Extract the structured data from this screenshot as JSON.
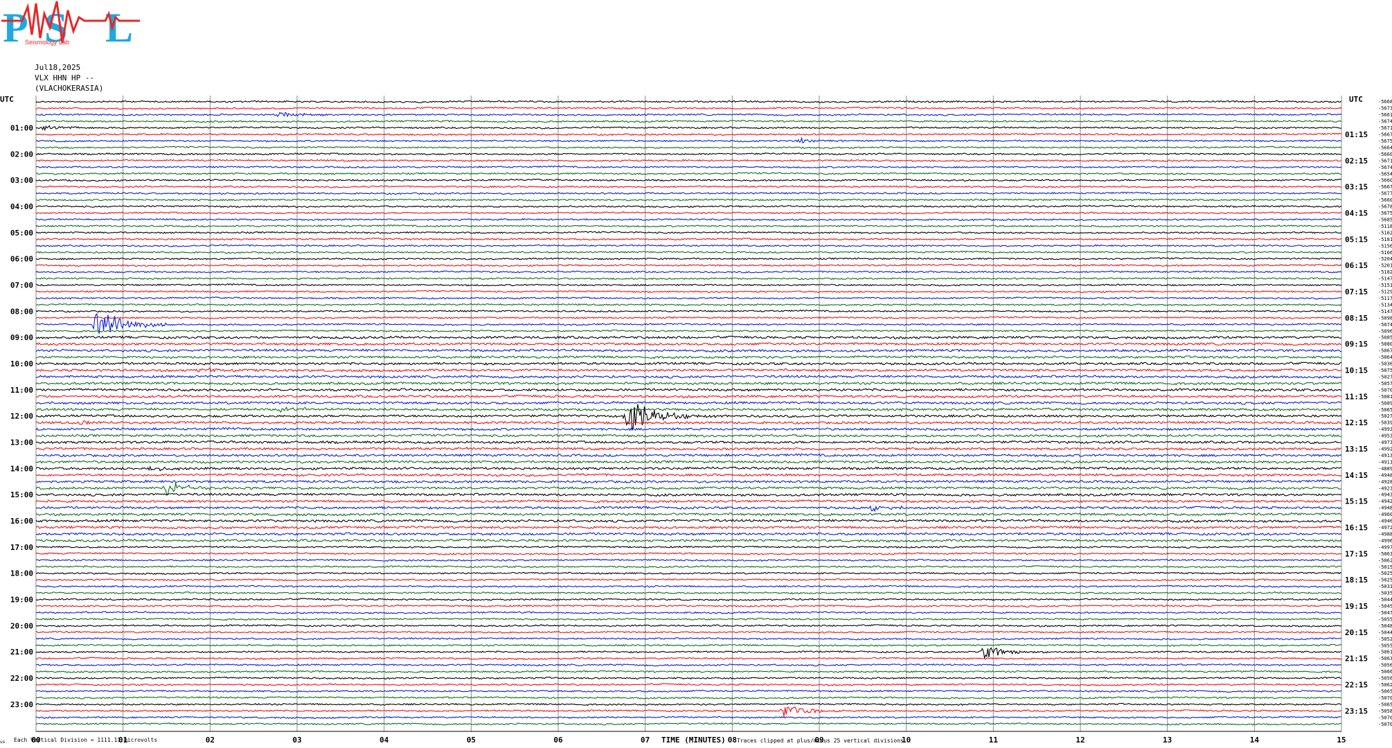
{
  "header": {
    "logo_text": "PSL",
    "logo_subtitle": "Seismology Lab",
    "date": "Jul18,2025",
    "station": "VLX HHN HP --",
    "site": "(VLACHOKERASIA)",
    "utc_label_left": "UTC",
    "utc_label_right": "UTC"
  },
  "footer": {
    "corner_mark": "us",
    "vertical_division": "Each Vertical Division = 1111.11 microvolts",
    "x_axis_label": "TIME (MINUTES)",
    "clip_note": "Traces clipped at plus/minus 25 vertical divisions"
  },
  "colors": {
    "trace_cycle": [
      "#000000",
      "#e8141a",
      "#0a1ed2",
      "#0f6e1e"
    ],
    "grid": "#8a8a8a",
    "logo_blue": "#20a8e0",
    "logo_red": "#e62828"
  },
  "chart_data": {
    "type": "line",
    "x_axis": {
      "label": "TIME (MINUTES)",
      "range": [
        0,
        15
      ],
      "tick_labels": [
        "00",
        "01",
        "02",
        "03",
        "04",
        "05",
        "06",
        "07",
        "08",
        "09",
        "10",
        "11",
        "12",
        "13",
        "14",
        "15"
      ]
    },
    "rows_per_hour": 4,
    "row_minutes": 15,
    "left_hour_labels": [
      "01:00",
      "02:00",
      "03:00",
      "04:00",
      "05:00",
      "06:00",
      "07:00",
      "08:00",
      "09:00",
      "10:00",
      "11:00",
      "12:00",
      "13:00",
      "14:00",
      "15:00",
      "16:00",
      "17:00",
      "18:00",
      "19:00",
      "20:00",
      "21:00",
      "22:00",
      "23:00"
    ],
    "right_hour_labels": [
      "01:15",
      "02:15",
      "03:15",
      "04:15",
      "05:15",
      "06:15",
      "07:15",
      "08:15",
      "09:15",
      "10:15",
      "11:15",
      "12:15",
      "13:15",
      "14:15",
      "15:15",
      "16:15",
      "17:15",
      "18:15",
      "19:15",
      "20:15",
      "21:15",
      "22:15",
      "23:15"
    ],
    "row_offsets": [
      "-5668",
      "-5673",
      "-5661",
      "-5674",
      "-5671",
      "-5667",
      "-5675",
      "-5664",
      "-5660",
      "-5671",
      "-5674",
      "-5654",
      "-5660",
      "-5667",
      "-5677",
      "-5660",
      "-5678",
      "-5675",
      "-5685",
      "-5118",
      "-5162",
      "-5181",
      "-5156",
      "-5166",
      "-5204",
      "-5201",
      "-5182",
      "-5147",
      "-5151",
      "-5129",
      "-5117",
      "-5134",
      "-5147",
      "-5098",
      "-5074",
      "-5096",
      "-5085",
      "-5080",
      "-5067",
      "-5064",
      "-5036",
      "-5075",
      "-5027",
      "-5057",
      "-5070",
      "-5081",
      "-5089",
      "-5065",
      "-5027",
      "-5039",
      "-4993",
      "-4953",
      "-4973",
      "-4992",
      "-4913",
      "-4911",
      "-4889",
      "-4948",
      "-4928",
      "-4923",
      "-4943",
      "-4942",
      "-4948",
      "-4960",
      "-4946",
      "-4972",
      "-4988",
      "-4996",
      "-4997",
      "-5063",
      "-5062",
      "-5015",
      "-5025",
      "-5025",
      "-5031",
      "-5035",
      "-5044",
      "-5045",
      "-5047",
      "-5055",
      "-5048",
      "-5044",
      "-5052",
      "-5055",
      "-5061",
      "-5063",
      "-5056",
      "-5066",
      "-5056",
      "-5062",
      "-5065",
      "-5070",
      "-5065",
      "-5058",
      "-5070",
      "-5070"
    ],
    "events": [
      {
        "hour": 0,
        "quarter": 2,
        "minute": 2.8,
        "amplitude": "small"
      },
      {
        "hour": 1,
        "quarter": 0,
        "minute": 0.1,
        "amplitude": "small"
      },
      {
        "hour": 1,
        "quarter": 2,
        "minute": 8.8,
        "amplitude": "small"
      },
      {
        "hour": 8,
        "quarter": 2,
        "minute": 0.7,
        "amplitude": "large"
      },
      {
        "hour": 10,
        "quarter": 1,
        "minute": 1.9,
        "amplitude": "small"
      },
      {
        "hour": 11,
        "quarter": 3,
        "minute": 2.8,
        "amplitude": "small"
      },
      {
        "hour": 12,
        "quarter": 0,
        "minute": 6.8,
        "amplitude": "large"
      },
      {
        "hour": 12,
        "quarter": 1,
        "minute": 0.5,
        "amplitude": "small"
      },
      {
        "hour": 14,
        "quarter": 0,
        "minute": 1.3,
        "amplitude": "small"
      },
      {
        "hour": 14,
        "quarter": 3,
        "minute": 1.5,
        "amplitude": "medium"
      },
      {
        "hour": 15,
        "quarter": 2,
        "minute": 9.6,
        "amplitude": "small"
      },
      {
        "hour": 21,
        "quarter": 0,
        "minute": 10.9,
        "amplitude": "medium"
      },
      {
        "hour": 23,
        "quarter": 1,
        "minute": 8.6,
        "amplitude": "medium"
      }
    ]
  }
}
